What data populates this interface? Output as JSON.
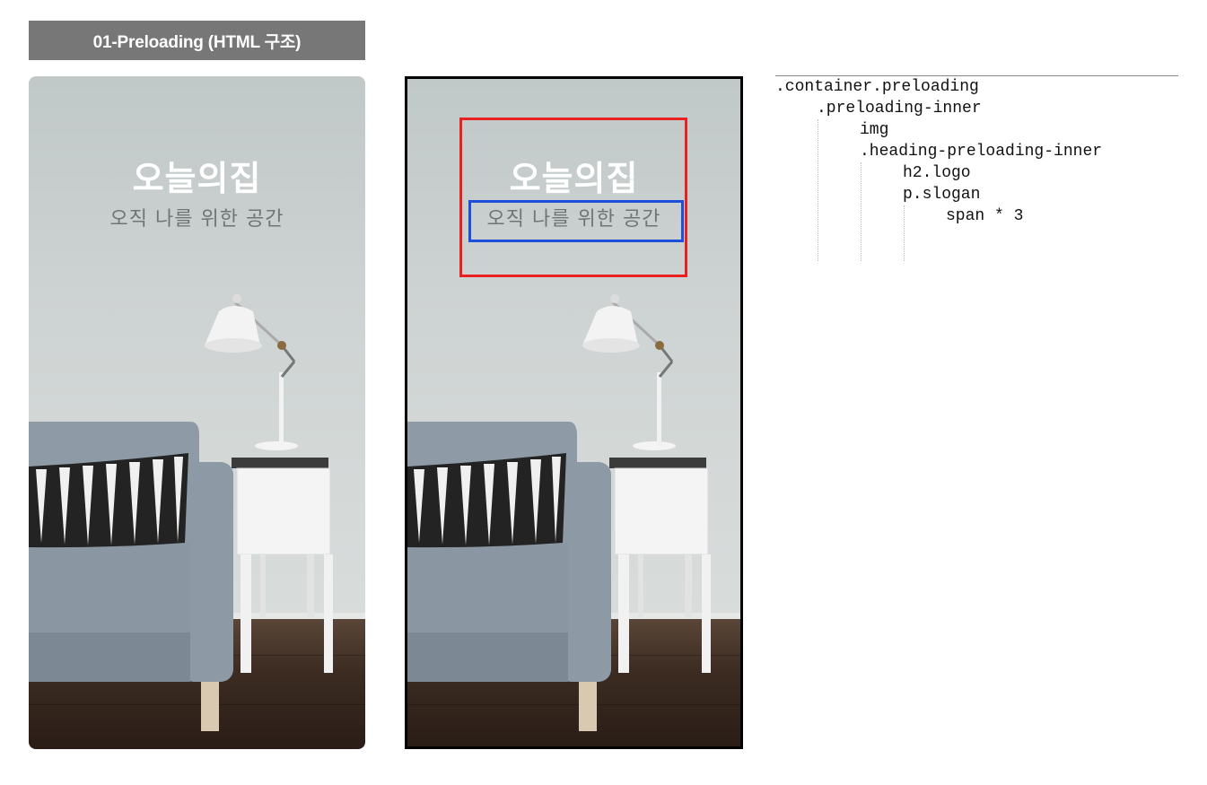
{
  "header": {
    "title": "01-Preloading (HTML 구조)"
  },
  "preview": {
    "logo": "오늘의집",
    "slogan_words": [
      "오직",
      "나를",
      "위한",
      "공간"
    ]
  },
  "html_tree": {
    "lines": [
      ".container.preloading",
      ".preloading-inner",
      "img",
      ".heading-preloading-inner",
      "h2.logo",
      "p.slogan",
      "span * 3"
    ]
  },
  "colors": {
    "title_bg": "#777777",
    "heading_box": "#e8201f",
    "slogan_box": "#1d4fd9",
    "logo_text": "#ffffff",
    "slogan_text": "#707474"
  },
  "icons": [
    "sofa-photo",
    "lamp-photo",
    "side-table-photo"
  ]
}
